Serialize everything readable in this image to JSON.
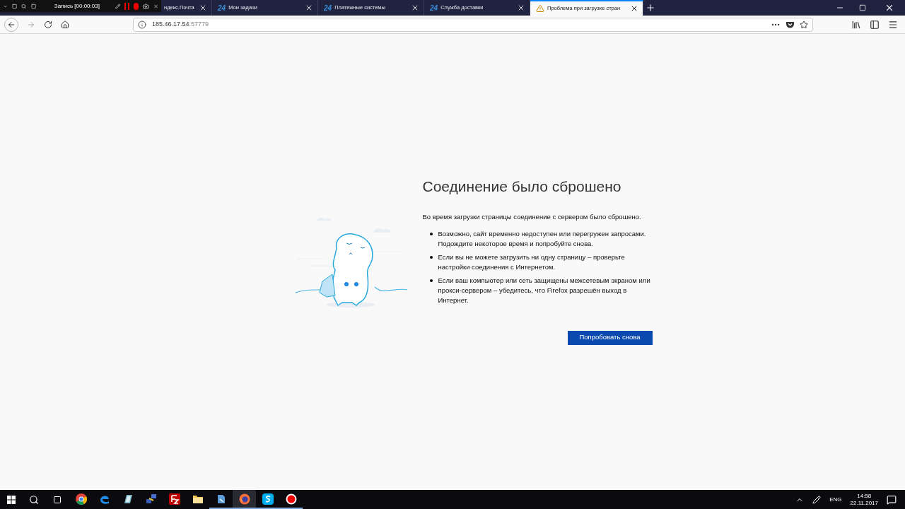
{
  "recorder": {
    "label": "Запись [00:00:03]"
  },
  "tabs": [
    {
      "kind": "plain",
      "title": "ндекс.Почта",
      "selected": false
    },
    {
      "kind": "badge",
      "badge": "24",
      "title": "Мои задачи",
      "selected": false
    },
    {
      "kind": "badge",
      "badge": "24",
      "title": "Платежные системы",
      "selected": false
    },
    {
      "kind": "badge",
      "badge": "24",
      "title": "Служба доставки",
      "selected": false
    },
    {
      "kind": "warning",
      "title": "Проблема при загрузке стран",
      "selected": true
    }
  ],
  "address": {
    "host": "185.46.17.54",
    "port": ":57779"
  },
  "error": {
    "title": "Соединение было сброшено",
    "intro": "Во время загрузки страницы соединение с сервером было сброшено.",
    "bullets": [
      "Возможно, сайт временно недоступен или перегружен запросами. Подождите некоторое время и попробуйте снова.",
      "Если вы не можете загрузить ни одну страницу – проверьте настройки соединения с Интернетом.",
      "Если ваш компьютер или сеть защищены межсетевым экраном или прокси-сервером – убедитесь, что Firefox разрешён выход в Интернет."
    ],
    "button": "Попробовать снова"
  },
  "taskbar": {
    "apps": [
      {
        "kind": "chrome",
        "running": false,
        "selected": false
      },
      {
        "kind": "edge",
        "running": false,
        "selected": false
      },
      {
        "kind": "notepad",
        "running": false,
        "selected": false
      },
      {
        "kind": "network",
        "running": false,
        "selected": false
      },
      {
        "kind": "filezilla",
        "running": false,
        "selected": false
      },
      {
        "kind": "folder",
        "running": false,
        "selected": false
      },
      {
        "kind": "document",
        "running": true,
        "selected": false
      },
      {
        "kind": "firefox",
        "running": true,
        "selected": true
      },
      {
        "kind": "skype",
        "running": true,
        "selected": false
      },
      {
        "kind": "record",
        "running": true,
        "selected": false
      }
    ],
    "language": "ENG",
    "time": "14:58",
    "date": "22.11.2017"
  }
}
